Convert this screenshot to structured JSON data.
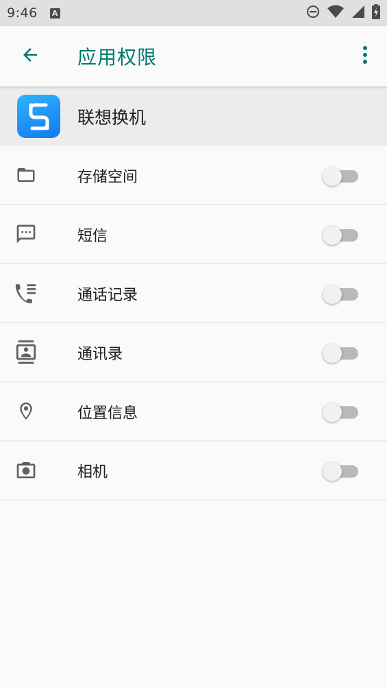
{
  "status_bar": {
    "time": "9:46",
    "notification_icon_letter": "A",
    "icons": [
      "dnd-icon",
      "wifi-icon",
      "signal-icon",
      "battery-charging-icon"
    ]
  },
  "app_bar": {
    "title": "应用权限",
    "back_icon": "arrow-left-icon",
    "more_icon": "more-vert-icon",
    "accent_color": "#00796b"
  },
  "app": {
    "name": "联想换机",
    "icon": "lenovo-switch-app-icon"
  },
  "permissions": [
    {
      "label": "存储空间",
      "icon": "folder-icon",
      "enabled": false
    },
    {
      "label": "短信",
      "icon": "sms-icon",
      "enabled": false
    },
    {
      "label": "通话记录",
      "icon": "call-log-icon",
      "enabled": false
    },
    {
      "label": "通讯录",
      "icon": "contacts-icon",
      "enabled": false
    },
    {
      "label": "位置信息",
      "icon": "location-icon",
      "enabled": false
    },
    {
      "label": "相机",
      "icon": "camera-icon",
      "enabled": false
    }
  ]
}
